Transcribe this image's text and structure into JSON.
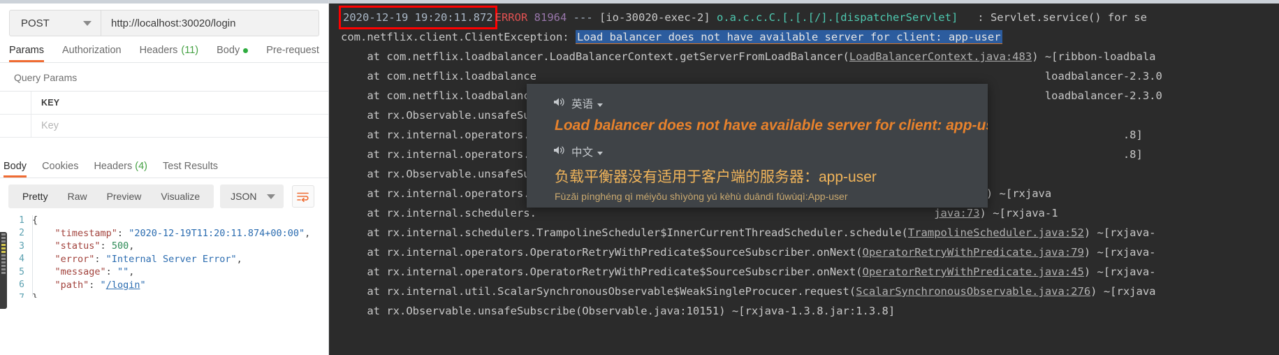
{
  "postman": {
    "method": "POST",
    "url": "http://localhost:30020/login",
    "request_tabs": [
      {
        "label": "Params",
        "active": true
      },
      {
        "label": "Authorization",
        "active": false
      },
      {
        "label": "Headers",
        "count": "(11)",
        "active": false
      },
      {
        "label": "Body",
        "dot": true,
        "active": false
      },
      {
        "label": "Pre-request",
        "active": false
      }
    ],
    "query_params_title": "Query Params",
    "table": {
      "headers": [
        "KEY"
      ],
      "rows": [
        {
          "key_placeholder": "Key"
        }
      ]
    },
    "response_tabs": [
      {
        "label": "Body",
        "active": true
      },
      {
        "label": "Cookies",
        "active": false
      },
      {
        "label": "Headers",
        "count": "(4)",
        "active": false
      },
      {
        "label": "Test Results",
        "active": false
      }
    ],
    "format_buttons": [
      "Pretty",
      "Raw",
      "Preview",
      "Visualize"
    ],
    "format_active": "Pretty",
    "language_select": "JSON",
    "wrap_icon": "word-wrap-icon",
    "code_lines": [
      {
        "n": "1",
        "text": "{"
      },
      {
        "n": "2",
        "text": "    \"timestamp\": \"2020-12-19T11:20:11.874+00:00\","
      },
      {
        "n": "3",
        "text": "    \"status\": 500,"
      },
      {
        "n": "4",
        "text": "    \"error\": \"Internal Server Error\","
      },
      {
        "n": "5",
        "text": "    \"message\": \"\","
      },
      {
        "n": "6",
        "text": "    \"path\": \"/login\""
      },
      {
        "n": "7",
        "text": "}"
      }
    ]
  },
  "console": {
    "header": {
      "timestamp": "2020-12-19 19:20:11.872",
      "level": "ERROR",
      "pid": "81964",
      "dashes": "---",
      "thread": "[io-30020-exec-2]",
      "logger": "o.a.c.c.C.[.[.[/].[dispatcherServlet]",
      "message": ": Servlet.service() for se"
    },
    "exception_class": "com.netflix.client.ClientException: ",
    "exception_message": "Load balancer does not have available server for client: app-user",
    "stack_lines": [
      "    at com.netflix.loadbalancer.LoadBalancerContext.getServerFromLoadBalancer(LoadBalancerContext.java:483) ~[ribbon-loadbala",
      "    at com.netflix.loadbalance                                                                              loadbalancer-2.3.0",
      "    at com.netflix.loadbalance                                                                              loadbalancer-2.3.0",
      "    at rx.Observable.unsafeSub",
      "    at rx.internal.operators.O                                                                                            .8]",
      "    at rx.internal.operators.O                                                                                            .8]",
      "    at rx.Observable.unsafeSub",
      "    at rx.internal.operators.O                                                                    java:127) ~[rxjava",
      "    at rx.internal.schedulers.                                                                     java:73) ~[rxjava-1",
      "    at rx.internal.schedulers.TrampolineScheduler$InnerCurrentThreadScheduler.schedule(TrampolineScheduler.java:52) ~[rxjava-",
      "    at rx.internal.operators.OperatorRetryWithPredicate$SourceSubscriber.onNext(OperatorRetryWithPredicate.java:79) ~[rxjava-",
      "    at rx.internal.operators.OperatorRetryWithPredicate$SourceSubscriber.onNext(OperatorRetryWithPredicate.java:45) ~[rxjava-",
      "    at rx.internal.util.ScalarSynchronousObservable$WeakSingleProcucer.request(ScalarSynchronousObservable.java:276) ~[rxjava"
    ]
  },
  "popup": {
    "source_lang": "英语",
    "source_text": "Load balancer does not have available server for client: app-user",
    "target_lang": "中文",
    "target_text": "负载平衡器没有适用于客户端的服务器：app-user",
    "pinyin": "Fùzǎi pínghéng qì méiyǒu shìyòng yú kèhù duāndì fúwùqì:App-user",
    "speaker_icon": "speaker-icon",
    "caret_icon": "chevron-down-icon"
  },
  "colors": {
    "accent_orange": "#ef6c33",
    "highlight_blue": "#2c5c9e",
    "error_red": "#e05252",
    "popup_bg": "#3f4347",
    "popup_orange": "#e8822c",
    "popup_yellow": "#f0b45a",
    "console_bg": "#2b2b2b"
  }
}
